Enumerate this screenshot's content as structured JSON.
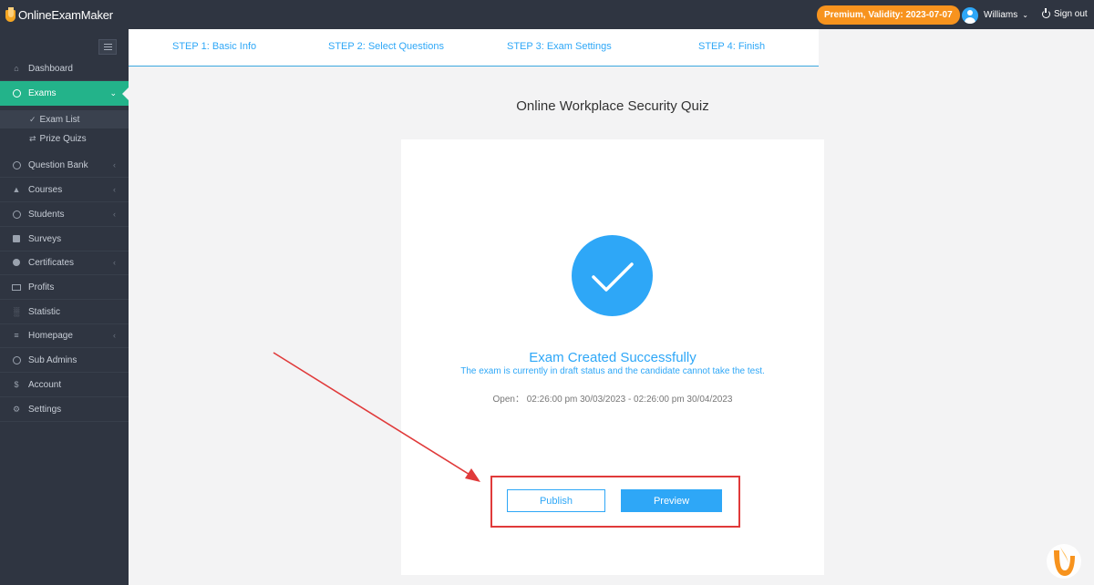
{
  "app": {
    "logo_text": "OnlineExamMaker",
    "premium_badge": "Premium, Validity: 2023-07-07",
    "user_name": "Williams",
    "sign_out": "Sign out"
  },
  "sidebar": {
    "items": [
      {
        "label": "Dashboard",
        "icon": "home-icon"
      },
      {
        "label": "Exams",
        "icon": "check-circle-icon",
        "active": true
      },
      {
        "label": "Question Bank",
        "icon": "question-icon"
      },
      {
        "label": "Courses",
        "icon": "graduation-cap-icon"
      },
      {
        "label": "Students",
        "icon": "users-icon"
      },
      {
        "label": "Surveys",
        "icon": "checkbox-icon"
      },
      {
        "label": "Certificates",
        "icon": "gear-icon"
      },
      {
        "label": "Profits",
        "icon": "credit-card-icon"
      },
      {
        "label": "Statistic",
        "icon": "bar-chart-icon"
      },
      {
        "label": "Homepage",
        "icon": "tree-icon"
      },
      {
        "label": "Sub Admins",
        "icon": "question-icon"
      },
      {
        "label": "Account",
        "icon": "dollar-icon"
      },
      {
        "label": "Settings",
        "icon": "gear-icon"
      }
    ],
    "sub_items": [
      {
        "label": "Exam List",
        "icon": "check-circle-icon",
        "active": true
      },
      {
        "label": "Prize Quizs",
        "icon": "shuffle-icon"
      }
    ]
  },
  "steps": [
    {
      "label": "STEP 1: Basic Info"
    },
    {
      "label": "STEP 2: Select Questions"
    },
    {
      "label": "STEP 3: Exam Settings"
    },
    {
      "label": "STEP 4: Finish"
    }
  ],
  "main": {
    "title": "Online Workplace Security Quiz",
    "success_title": "Exam Created Successfully",
    "success_sub": "The exam is currently in draft status and the candidate cannot take the test.",
    "open_range": "Open： 02:26:00 pm 30/03/2023 - 02:26:00 pm 30/04/2023",
    "publish_label": "Publish",
    "preview_label": "Preview"
  },
  "colors": {
    "accent": "#2ea7f7",
    "sidebar_bg": "#2f3541",
    "active_green": "#23b38a",
    "premium_orange": "#f7931e",
    "highlight_red": "#e03a3a"
  }
}
